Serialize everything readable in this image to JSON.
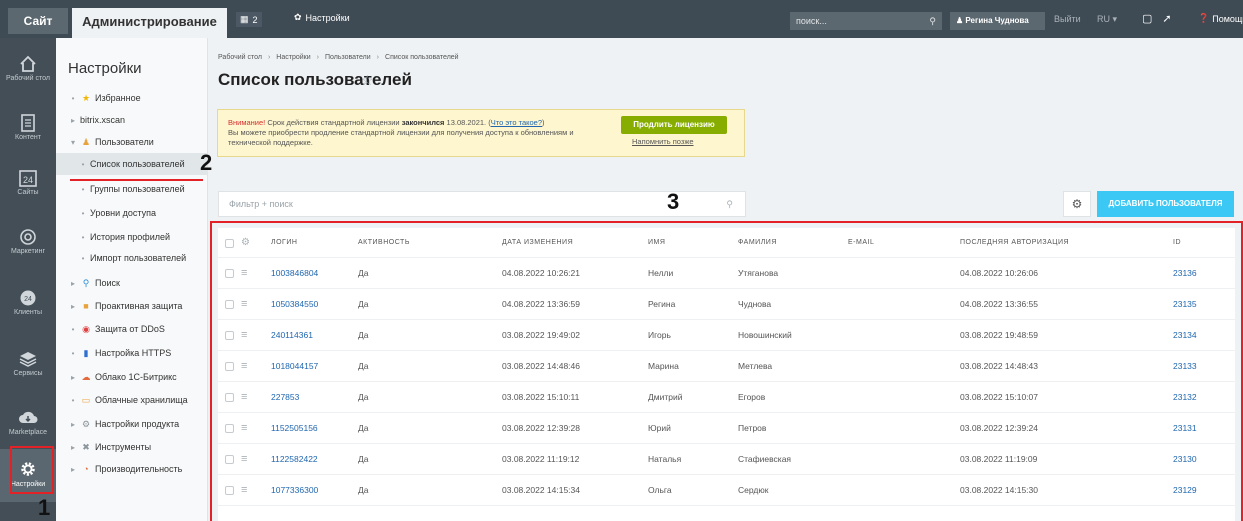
{
  "topbar": {
    "site_tab": "Сайт",
    "admin_tab": "Администрирование",
    "notifications_count": "2",
    "settings_label": "Настройки",
    "search_placeholder": "поиск...",
    "user_name": "Регина Чуднова",
    "logout": "Выйти",
    "lang": "RU",
    "help": "Помощь"
  },
  "iconbar": [
    {
      "icon": "home-icon",
      "label": "Рабочий стол"
    },
    {
      "icon": "content-icon",
      "label": "Контент"
    },
    {
      "icon": "sites-icon",
      "label": "Сайты",
      "badge": "24"
    },
    {
      "icon": "marketing-icon",
      "label": "Маркетинг"
    },
    {
      "icon": "clients-icon",
      "label": "Клиенты"
    },
    {
      "icon": "services-icon",
      "label": "Сервисы"
    },
    {
      "icon": "marketplace-icon",
      "label": "Marketplace"
    },
    {
      "icon": "gear-icon",
      "label": "Настройки"
    }
  ],
  "annotations": {
    "one": "1",
    "two": "2",
    "three": "3"
  },
  "nav": {
    "title": "Настройки",
    "items": [
      {
        "marker": "•",
        "icon": "star-icon",
        "label": "Избранное"
      },
      {
        "marker": "▸",
        "icon": "",
        "label": "bitrix.xscan"
      },
      {
        "marker": "▾",
        "icon": "user-icon",
        "label": "Пользователи"
      },
      {
        "marker": "•",
        "icon": "",
        "label": "Список пользователей"
      },
      {
        "marker": "•",
        "icon": "",
        "label": "Группы пользователей"
      },
      {
        "marker": "•",
        "icon": "",
        "label": "Уровни доступа"
      },
      {
        "marker": "•",
        "icon": "",
        "label": "История профилей"
      },
      {
        "marker": "•",
        "icon": "",
        "label": "Импорт пользователей"
      },
      {
        "marker": "▸",
        "icon": "search-icon",
        "label": "Поиск"
      },
      {
        "marker": "▸",
        "icon": "lock-icon",
        "label": "Проактивная защита"
      },
      {
        "marker": "•",
        "icon": "ddos-icon",
        "label": "Защита от DDoS"
      },
      {
        "marker": "•",
        "icon": "https-icon",
        "label": "Настройка HTTPS"
      },
      {
        "marker": "▸",
        "icon": "cloud-icon",
        "label": "Облако 1С-Битрикс"
      },
      {
        "marker": "•",
        "icon": "storage-icon",
        "label": "Облачные хранилища"
      },
      {
        "marker": "▸",
        "icon": "settings-icon",
        "label": "Настройки продукта"
      },
      {
        "marker": "▸",
        "icon": "tools-icon",
        "label": "Инструменты"
      },
      {
        "marker": "▸",
        "icon": "speed-icon",
        "label": "Производительность"
      }
    ]
  },
  "breadcrumb": [
    "Рабочий стол",
    "Настройки",
    "Пользователи",
    "Список пользователей"
  ],
  "page_title": "Список пользователей",
  "warning": {
    "attention": "Внимание!",
    "text1": " Срок действия стандартной лицензии ",
    "expired": "закончился",
    "text2": " 13.08.2021. (",
    "link": "Что это такое?",
    "text3": ")",
    "line2": "Вы можете приобрести продление стандартной лицензии для получения доступа к обновлениям и технической поддержке.",
    "renew_button": "Продлить лицензию",
    "remind_later": "Напомнить позже"
  },
  "filter": {
    "placeholder": "Фильтр + поиск"
  },
  "add_user_button": "ДОБАВИТЬ ПОЛЬЗОВАТЕЛЯ",
  "table": {
    "columns": {
      "login": "ЛОГИН",
      "active": "АКТИВНОСТЬ",
      "date": "ДАТА ИЗМЕНЕНИЯ",
      "name": "ИМЯ",
      "surname": "ФАМИЛИЯ",
      "email": "E-MAIL",
      "last_auth": "ПОСЛЕДНЯЯ АВТОРИЗАЦИЯ",
      "id": "ID"
    },
    "rows": [
      {
        "login": "1003846804",
        "active": "Да",
        "date": "04.08.2022 10:26:21",
        "name": "Нелли",
        "surname": "Утяганова",
        "email": "",
        "last_auth": "04.08.2022 10:26:06",
        "id": "23136"
      },
      {
        "login": "1050384550",
        "active": "Да",
        "date": "04.08.2022 13:36:59",
        "name": "Регина",
        "surname": "Чуднова",
        "email": "",
        "last_auth": "04.08.2022 13:36:55",
        "id": "23135"
      },
      {
        "login": "240114361",
        "active": "Да",
        "date": "03.08.2022 19:49:02",
        "name": "Игорь",
        "surname": "Новошинский",
        "email": "",
        "last_auth": "03.08.2022 19:48:59",
        "id": "23134"
      },
      {
        "login": "1018044157",
        "active": "Да",
        "date": "03.08.2022 14:48:46",
        "name": "Марина",
        "surname": "Метлева",
        "email": "",
        "last_auth": "03.08.2022 14:48:43",
        "id": "23133"
      },
      {
        "login": "227853",
        "active": "Да",
        "date": "03.08.2022 15:10:11",
        "name": "Дмитрий",
        "surname": "Егоров",
        "email": "",
        "last_auth": "03.08.2022 15:10:07",
        "id": "23132"
      },
      {
        "login": "1152505156",
        "active": "Да",
        "date": "03.08.2022 12:39:28",
        "name": "Юрий",
        "surname": "Петров",
        "email": "",
        "last_auth": "03.08.2022 12:39:24",
        "id": "23131"
      },
      {
        "login": "1122582422",
        "active": "Да",
        "date": "03.08.2022 11:19:12",
        "name": "Наталья",
        "surname": "Стафиевская",
        "email": "",
        "last_auth": "03.08.2022 11:19:09",
        "id": "23130"
      },
      {
        "login": "1077336300",
        "active": "Да",
        "date": "03.08.2022 14:15:34",
        "name": "Ольга",
        "surname": "Сердюк",
        "email": "",
        "last_auth": "03.08.2022 14:15:30",
        "id": "23129"
      }
    ]
  },
  "colors": {
    "topbar": "#3f4b54",
    "iconbar": "#434e56",
    "accent_blue": "#3bc8f5",
    "renew_green": "#86ad00",
    "annotation_red": "#e32228",
    "link": "#2067b0"
  }
}
